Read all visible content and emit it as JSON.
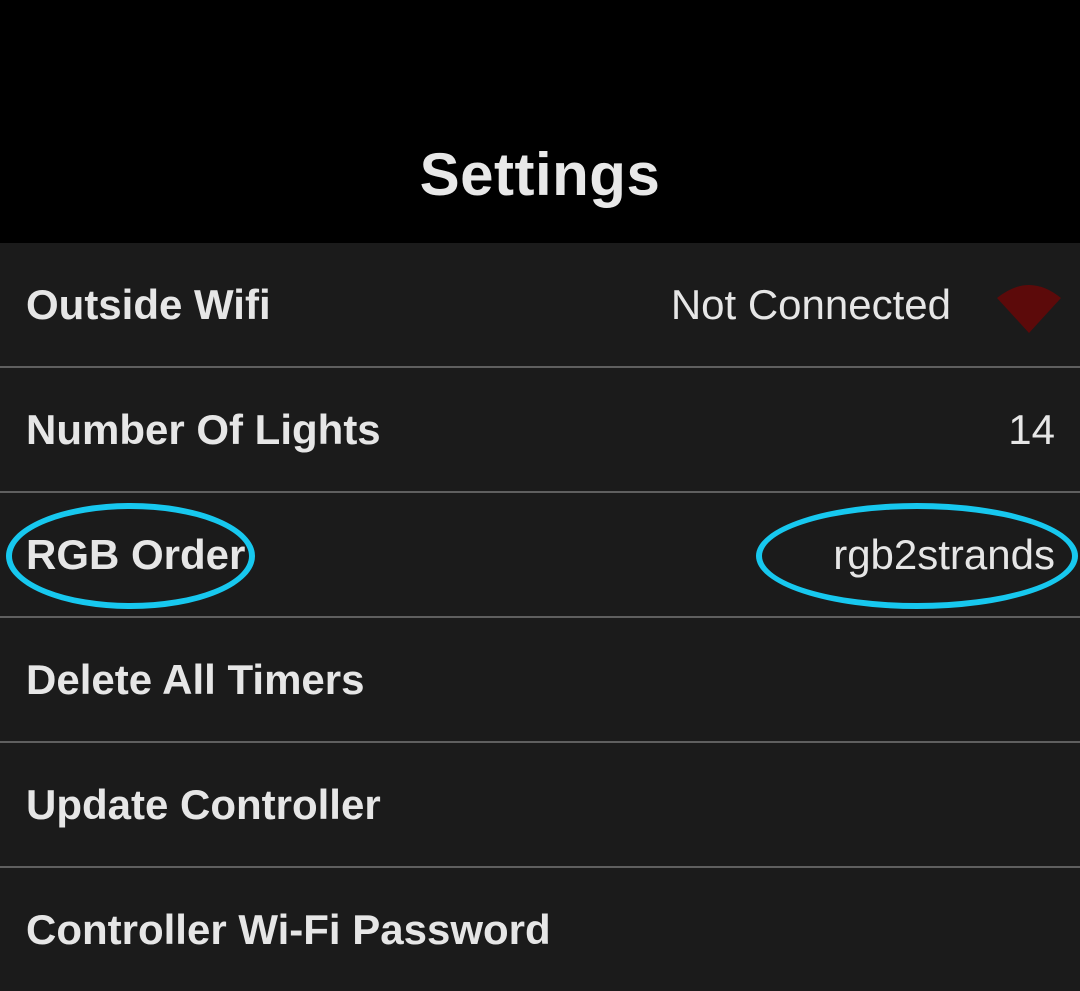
{
  "header": {
    "title": "Settings"
  },
  "rows": [
    {
      "label": "Outside Wifi",
      "value": "Not Connected",
      "icon": "wifi-icon"
    },
    {
      "label": "Number Of Lights",
      "value": "14"
    },
    {
      "label": "RGB Order",
      "value": "rgb2strands"
    },
    {
      "label": "Delete All Timers"
    },
    {
      "label": "Update Controller"
    },
    {
      "label": "Controller Wi-Fi Password"
    }
  ],
  "colors": {
    "background": "#000000",
    "row_background": "#1b1b1b",
    "divider": "#5f5f5f",
    "text": "#e6e6e6",
    "wifi_disconnected": "#5c0a0a",
    "annotation_highlight": "#17c8ef"
  }
}
